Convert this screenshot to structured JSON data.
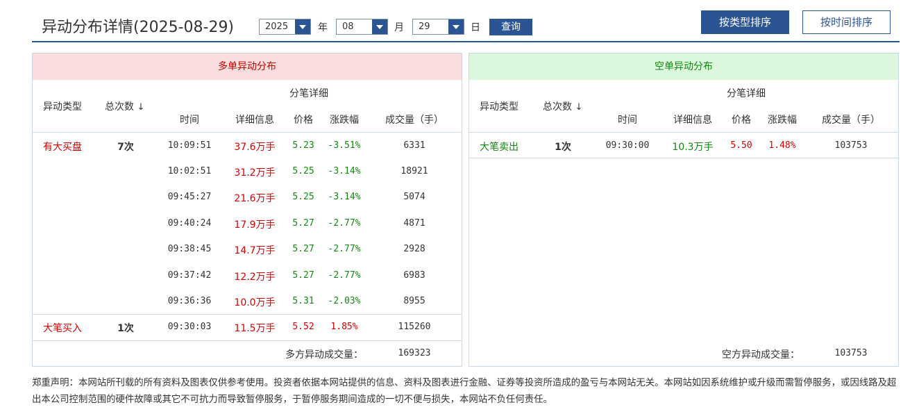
{
  "header": {
    "title": "异动分布详情(2025-08-29)",
    "year": "2025",
    "year_unit": "年",
    "month": "08",
    "month_unit": "月",
    "day": "29",
    "day_unit": "日",
    "query_label": "查询",
    "sort_by_type": "按类型排序",
    "sort_by_time": "按时间排序"
  },
  "long_panel": {
    "title": "多单异动分布",
    "col_type": "异动类型",
    "col_count": "总次数",
    "sort_arrow": "↓",
    "col_group": "分笔详细",
    "col_time": "时间",
    "col_info": "详细信息",
    "col_price": "价格",
    "col_change": "涨跌幅",
    "col_volume": "成交量（手）",
    "groups": [
      {
        "type": "有大买盘",
        "count": "7次",
        "rows": [
          {
            "time": "10:09:51",
            "info": "37.6万手",
            "price": "5.23",
            "change": "-3.51%",
            "volume": "6331"
          },
          {
            "time": "10:02:51",
            "info": "31.2万手",
            "price": "5.25",
            "change": "-3.14%",
            "volume": "18921"
          },
          {
            "time": "09:45:27",
            "info": "21.6万手",
            "price": "5.25",
            "change": "-3.14%",
            "volume": "5074"
          },
          {
            "time": "09:40:24",
            "info": "17.9万手",
            "price": "5.27",
            "change": "-2.77%",
            "volume": "4871"
          },
          {
            "time": "09:38:45",
            "info": "14.7万手",
            "price": "5.27",
            "change": "-2.77%",
            "volume": "2928"
          },
          {
            "time": "09:37:42",
            "info": "12.2万手",
            "price": "5.27",
            "change": "-2.77%",
            "volume": "6983"
          },
          {
            "time": "09:36:36",
            "info": "10.0万手",
            "price": "5.31",
            "change": "-2.03%",
            "volume": "8955"
          }
        ]
      },
      {
        "type": "大笔买入",
        "count": "1次",
        "rows": [
          {
            "time": "09:30:03",
            "info": "11.5万手",
            "price": "5.52",
            "change": "1.85%",
            "volume": "115260"
          }
        ]
      }
    ],
    "total_label": "多方异动成交量：",
    "total_value": "169323"
  },
  "short_panel": {
    "title": "空单异动分布",
    "col_type": "异动类型",
    "col_count": "总次数",
    "sort_arrow": "↓",
    "col_group": "分笔详细",
    "col_time": "时间",
    "col_info": "详细信息",
    "col_price": "价格",
    "col_change": "涨跌幅",
    "col_volume": "成交量（手）",
    "groups": [
      {
        "type": "大笔卖出",
        "count": "1次",
        "rows": [
          {
            "time": "09:30:00",
            "info": "10.3万手",
            "price": "5.50",
            "change": "1.48%",
            "volume": "103753"
          }
        ]
      }
    ],
    "total_label": "空方异动成交量：",
    "total_value": "103753"
  },
  "disclaimer": "郑重声明：本网站所刊载的所有资料及图表仅供参考使用。投资者依据本网站提供的信息、资料及图表进行金融、证券等投资所造成的盈亏与本网站无关。本网站如因系统维护或升级而需暂停服务，或因线路及超出本公司控制范围的硬件故障或其它不可抗力而导致暂停服务，于暂停服务期间造成的一切不便与损失，本网站不负任何责任。",
  "colors": {
    "brand_blue": "#2b5592",
    "long_red": "#d60000",
    "short_green": "#118811",
    "long_header_bg": "#fadede",
    "short_header_bg": "#dcf8dc"
  }
}
